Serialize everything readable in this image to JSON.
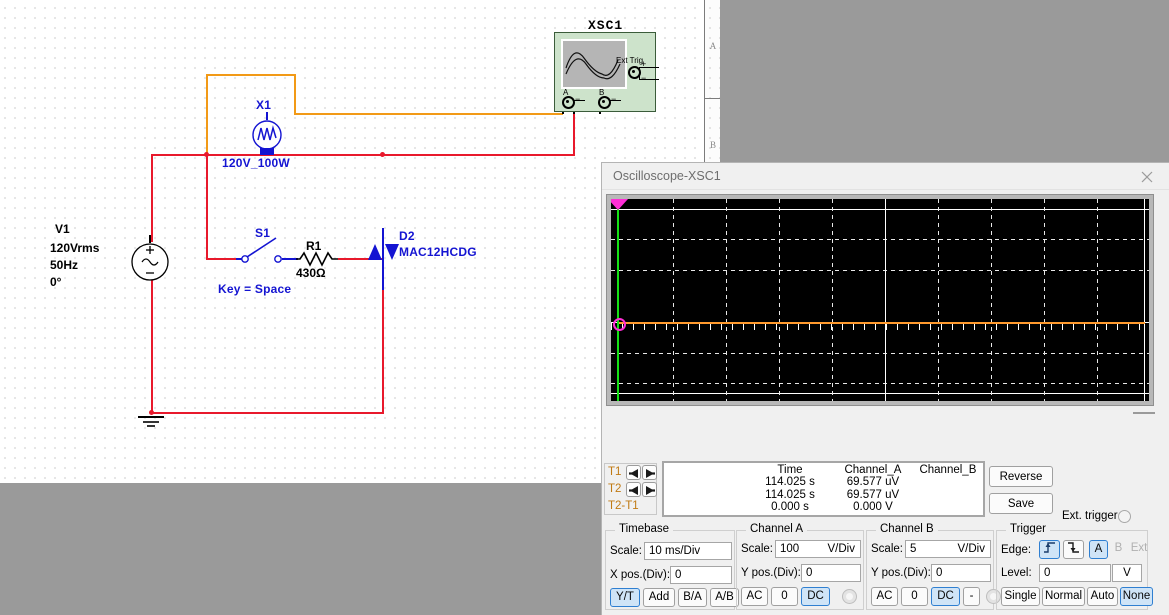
{
  "schematic": {
    "instrument_label": "XSC1",
    "instrument_terminals": {
      "a": "A",
      "b": "B",
      "ext": "Ext Trig"
    },
    "components": [
      {
        "ref": "V1",
        "lines": [
          "V1",
          "120Vrms",
          "50Hz",
          "0°"
        ]
      },
      {
        "ref": "X1",
        "label": "X1",
        "value": "120V_100W"
      },
      {
        "ref": "S1",
        "label": "S1",
        "key": "Key = Space"
      },
      {
        "ref": "R1",
        "label": "R1",
        "value": "430Ω"
      },
      {
        "ref": "D2",
        "label": "D2",
        "value": "MAC12HCDG"
      }
    ],
    "v1_label": "V1",
    "v1_vrms": "120Vrms",
    "v1_freq": "50Hz",
    "v1_phase": "0°",
    "x1_label": "X1",
    "x1_value": "120V_100W",
    "s1_label": "S1",
    "s1_key": "Key = Space",
    "r1_label": "R1",
    "r1_value": "430Ω",
    "d2_label": "D2",
    "d2_value": "MAC12HCDG",
    "scroll_marks": [
      "A",
      "B"
    ],
    "wire_colors": {
      "red": "#e8192c",
      "orange": "#f29a17",
      "blue": "#1414d2",
      "black": "#000000"
    }
  },
  "scope": {
    "title": "Oscilloscope-XSC1",
    "close_label": "×",
    "display": {
      "background": "#000000",
      "grid_color": "#e8e8e8",
      "trace_color": "#ff9a2e",
      "cursor_color": "#14e014",
      "cursor_flag_color": "#ff2ed6",
      "columns": 8,
      "rows": 6
    },
    "cursors": {
      "t1": "T1",
      "t2": "T2",
      "delta": "T2-T1"
    },
    "measurements": {
      "headers": [
        "",
        "Time",
        "Channel_A",
        "Channel_B"
      ],
      "rows": [
        {
          "name": "T1",
          "time": "114.025 s",
          "channel_a": "69.577 uV",
          "channel_b": ""
        },
        {
          "name": "T2",
          "time": "114.025 s",
          "channel_a": "69.577 uV",
          "channel_b": ""
        },
        {
          "name": "T2-T1",
          "time": "0.000 s",
          "channel_a": "0.000 V",
          "channel_b": ""
        }
      ]
    },
    "reverse_label": "Reverse",
    "save_label": "Save",
    "ext_trigger_label": "Ext. trigger",
    "timebase": {
      "caption": "Timebase",
      "scale_label": "Scale:",
      "scale_value": "10 ms/Div",
      "xpos_label": "X pos.(Div):",
      "xpos_value": "0",
      "modes": [
        "Y/T",
        "Add",
        "B/A",
        "A/B"
      ],
      "active_mode": "Y/T"
    },
    "channel_a": {
      "caption": "Channel A",
      "scale_label": "Scale:",
      "scale_value": "100",
      "scale_unit": "V/Div",
      "ypos_label": "Y pos.(Div):",
      "ypos_value": "0",
      "coupling": [
        "AC",
        "0",
        "DC"
      ],
      "active_coupling": "DC"
    },
    "channel_b": {
      "caption": "Channel B",
      "scale_label": "Scale:",
      "scale_value": "5",
      "scale_unit": "V/Div",
      "ypos_label": "Y pos.(Div):",
      "ypos_value": "0",
      "coupling": [
        "AC",
        "0",
        "DC",
        "-"
      ],
      "active_coupling": "DC"
    },
    "trigger": {
      "caption": "Trigger",
      "edge_label": "Edge:",
      "edge_sources": [
        "A",
        "B",
        "Ext"
      ],
      "active_edge_source": "A",
      "active_slope": "rising",
      "level_label": "Level:",
      "level_value": "0",
      "level_unit": "V",
      "modes": [
        "Single",
        "Normal",
        "Auto",
        "None"
      ],
      "active_mode": "None"
    }
  }
}
